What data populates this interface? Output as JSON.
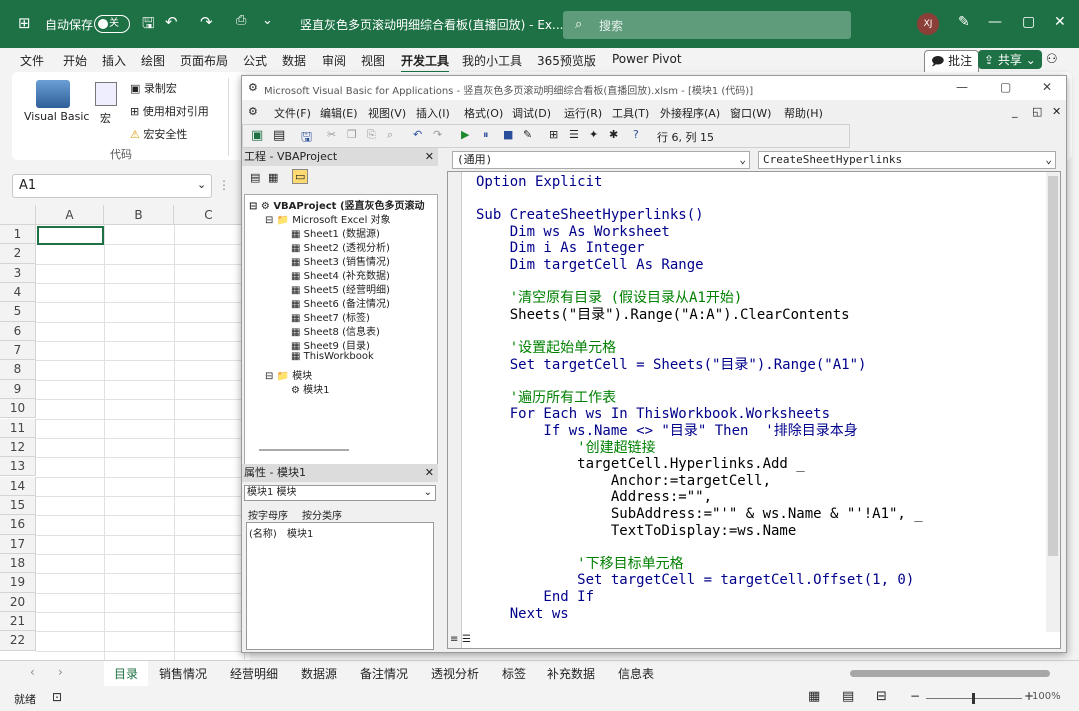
{
  "excel": {
    "autosave_label": "自动保存",
    "autosave_state": "关",
    "title": "竖直灰色多页滚动明细综合看板(直播回放) - Ex...",
    "search_placeholder": "搜索",
    "avatar": "XJ",
    "menu": [
      "文件",
      "开始",
      "插入",
      "绘图",
      "页面布局",
      "公式",
      "数据",
      "审阅",
      "视图",
      "开发工具",
      "我的小工具",
      "365预览版",
      "Power Pivot"
    ],
    "comments_label": "批注",
    "share_label": "共享",
    "ribbon": {
      "visual_basic": "Visual Basic",
      "macros": "宏",
      "record_macro": "录制宏",
      "relative_ref": "使用相对引用",
      "macro_security": "宏安全性",
      "group_label": "代码"
    },
    "namebox": "A1",
    "columns": [
      "A",
      "B",
      "C"
    ],
    "rows": [
      "1",
      "2",
      "3",
      "4",
      "5",
      "6",
      "7",
      "8",
      "9",
      "10",
      "11",
      "12",
      "13",
      "14",
      "15",
      "16",
      "17",
      "18",
      "19",
      "20",
      "21",
      "22"
    ],
    "tabs": [
      "目录",
      "销售情况",
      "经营明细",
      "数据源",
      "备注情况",
      "透视分析",
      "标签",
      "补充数据",
      "信息表"
    ],
    "active_tab": "目录",
    "status_ready": "就绪",
    "zoom": "100%"
  },
  "vbe": {
    "title": "Microsoft Visual Basic for Applications - 竖直灰色多页滚动明细综合看板(直播回放).xlsm - [模块1 (代码)]",
    "menu": [
      "文件(F)",
      "编辑(E)",
      "视图(V)",
      "插入(I)",
      "格式(O)",
      "调试(D)",
      "运行(R)",
      "工具(T)",
      "外接程序(A)",
      "窗口(W)",
      "帮助(H)"
    ],
    "cursor_pos": "行 6, 列 15",
    "project_title": "工程 - VBAProject",
    "tree": {
      "root": "VBAProject (竖直灰色多页滚动",
      "excel_objects": "Microsoft Excel 对象",
      "sheets": [
        "Sheet1 (数据源)",
        "Sheet2 (透视分析)",
        "Sheet3 (销售情况)",
        "Sheet4 (补充数据)",
        "Sheet5 (经营明细)",
        "Sheet6 (备注情况)",
        "Sheet7 (标签)",
        "Sheet8 (信息表)",
        "Sheet9 (目录)",
        "ThisWorkbook"
      ],
      "modules": "模块",
      "module1": "模块1"
    },
    "props_title": "属性 - 模块1",
    "props_select": "模块1 模块",
    "props_tabs": [
      "按字母序",
      "按分类序"
    ],
    "props_row_name": "(名称)",
    "props_row_value": "模块1",
    "combo_left": "(通用)",
    "combo_right": "CreateSheetHyperlinks",
    "code": [
      "Option Explicit",
      "",
      "Sub CreateSheetHyperlinks()",
      "    Dim ws As Worksheet",
      "    Dim i As Integer",
      "    Dim targetCell As Range",
      "",
      "    '清空原有目录 (假设目录从A1开始)",
      "    Sheets(\"目录\").Range(\"A:A\").ClearContents",
      "",
      "    '设置起始单元格",
      "    Set targetCell = Sheets(\"目录\").Range(\"A1\")",
      "",
      "    '遍历所有工作表",
      "    For Each ws In ThisWorkbook.Worksheets",
      "        If ws.Name <> \"目录\" Then  '排除目录本身",
      "            '创建超链接",
      "            targetCell.Hyperlinks.Add _",
      "                Anchor:=targetCell,",
      "                Address:=\"\",",
      "                SubAddress:=\"'\" & ws.Name & \"'!A1\", _",
      "                TextToDisplay:=ws.Name",
      "",
      "            '下移目标单元格",
      "            Set targetCell = targetCell.Offset(1, 0)",
      "        End If",
      "    Next ws"
    ],
    "code_kinds": [
      "kw",
      "",
      "kw",
      "kw",
      "kw",
      "kw",
      "",
      "cm",
      "",
      "",
      "cm",
      "kw",
      "",
      "cm",
      "kw",
      "kw",
      "cm",
      "",
      "",
      "",
      "",
      "",
      "",
      "cm",
      "kw",
      "kw",
      "kw"
    ]
  }
}
